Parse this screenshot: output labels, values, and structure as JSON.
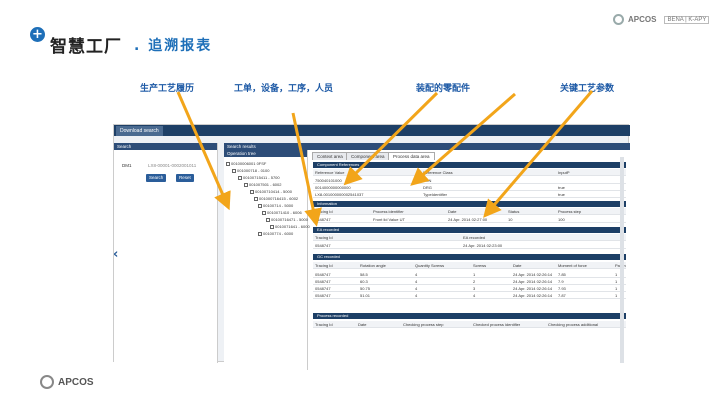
{
  "header": {
    "title": "智慧工厂",
    "subtitle": ". 追溯报表"
  },
  "brand": {
    "name": "APCOS",
    "box": "BENA | K-APY"
  },
  "callouts": [
    "生产工艺履历",
    "工单，设备，工序，人员",
    "装配的零配件",
    "关键工艺参数"
  ],
  "app": {
    "download_tab": "Download search",
    "search_header": "Search",
    "search_label": "DM1",
    "search_value": "LX8-00001-0002001011",
    "search_button": "Search",
    "reset_button": "Reset",
    "results_header": "Search results",
    "operation_tree": "Operation tree",
    "tree_items": [
      "00100006001 0FSF",
      "001000718 - 0100",
      "00100715411 - 5700",
      "001007501 - 6002",
      "00100710414 - 5000",
      "001000716415 - 6002",
      "00100714 - 5000",
      "0010071410 - 6006",
      "00100716471 - 5000",
      "0010071641 - 6000",
      "00100774 - 6000"
    ],
    "tabs": [
      "Context area",
      "Component area",
      "Process data area"
    ],
    "sec1": {
      "title": "Component References",
      "headers": [
        "Reference Value",
        "Reference Class",
        "InputP"
      ],
      "rows": [
        [
          "750040101000",
          "PRN",
          ""
        ],
        [
          "0014000000000000",
          "DRG",
          "true"
        ],
        [
          "LX8-001000000002541037",
          "TypeIdentifier",
          "true"
        ]
      ]
    },
    "sec2": {
      "title": "Information",
      "headers": [
        "Tracing Id",
        "Process identifier",
        "Date",
        "Status",
        "Process step"
      ],
      "row": [
        "0548747",
        "Front lid Value UT",
        "24 Apr. 2014 02:27:00",
        "10",
        "100"
      ]
    },
    "sec3": {
      "title": "EA recorded",
      "headers": [
        "Tracing Id",
        "EA recorded"
      ],
      "row": [
        "0548747",
        "24 Apr. 2014 02:23:00"
      ]
    },
    "sec4": {
      "title": "GC recorded",
      "headers": [
        "Tracing Id",
        "Rotation angle",
        "Quantity Screws",
        "Screws",
        "Date",
        "Moment of force",
        "Paren"
      ],
      "rows": [
        [
          "0548747",
          "58.5",
          "4",
          "1",
          "24 Apr. 2014 02:26:14",
          "7.85",
          "1"
        ],
        [
          "0548747",
          "60.3",
          "4",
          "2",
          "24 Apr. 2014 02:26:14",
          "7.9",
          "1"
        ],
        [
          "0548747",
          "50.75",
          "4",
          "3",
          "24 Apr. 2014 02:26:14",
          "7.93",
          "1"
        ],
        [
          "0548747",
          "51.01",
          "4",
          "4",
          "24 Apr. 2014 02:26:14",
          "7.87",
          "1"
        ]
      ]
    },
    "sec5": {
      "title": "Process recorded",
      "headers": [
        "Tracing Id",
        "Date",
        "Checking process step",
        "Checked process identifier",
        "Checking process additional"
      ]
    }
  }
}
